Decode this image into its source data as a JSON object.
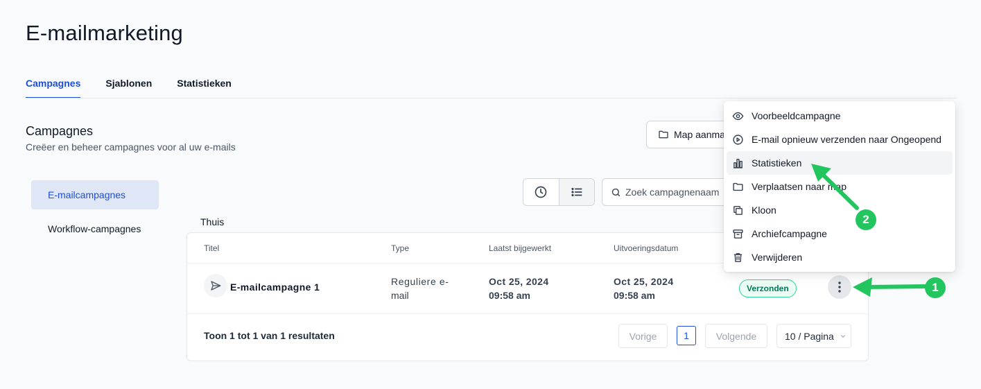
{
  "page": {
    "title": "E-mailmarketing"
  },
  "tabs": [
    {
      "label": "Campagnes",
      "active": true
    },
    {
      "label": "Sjablonen",
      "active": false
    },
    {
      "label": "Statistieken",
      "active": false
    }
  ],
  "section": {
    "title": "Campagnes",
    "subtitle": "Creëer en beheer campagnes voor al uw e-mails"
  },
  "toolbar": {
    "folder_button_label": "Map aanmaken",
    "search_placeholder": "Zoek campagnenaam"
  },
  "sidebar": {
    "items": [
      {
        "label": "E-mailcampagnes",
        "active": true
      },
      {
        "label": "Workflow-campagnes",
        "active": false
      }
    ]
  },
  "folder": {
    "label": "Thuis"
  },
  "table": {
    "headers": [
      "Titel",
      "Type",
      "Laatst bijgewerkt",
      "Uitvoeringsdatum"
    ],
    "rows": [
      {
        "title": "E-mailcampagne 1",
        "type_line1": "Reguliere e-",
        "type_line2": "mail",
        "updated_date": "Oct 25, 2024",
        "updated_time": "09:58 am",
        "run_date": "Oct 25, 2024",
        "run_time": "09:58 am",
        "status": "Verzonden"
      }
    ]
  },
  "pagination": {
    "results_text": "Toon 1 tot 1 van 1 resultaten",
    "prev_label": "Vorige",
    "current_page": "1",
    "next_label": "Volgende",
    "page_size_label": "10 / Pagina"
  },
  "context_menu": {
    "items": [
      {
        "label": "Voorbeeldcampagne",
        "icon": "eye-icon"
      },
      {
        "label": "E-mail opnieuw verzenden naar Ongeopend",
        "icon": "play-circle-icon"
      },
      {
        "label": "Statistieken",
        "icon": "bar-chart-icon",
        "hovered": true
      },
      {
        "label": "Verplaatsen naar map",
        "icon": "folder-icon"
      },
      {
        "label": "Kloon",
        "icon": "copy-icon"
      },
      {
        "label": "Archiefcampagne",
        "icon": "archive-icon"
      },
      {
        "label": "Verwijderen",
        "icon": "trash-icon"
      }
    ]
  },
  "annotations": {
    "marker_1": "1",
    "marker_2": "2",
    "color": "#22c55e"
  },
  "colors": {
    "accent": "#1d4ed8",
    "success": "#047857",
    "background": "#f9fafb"
  }
}
